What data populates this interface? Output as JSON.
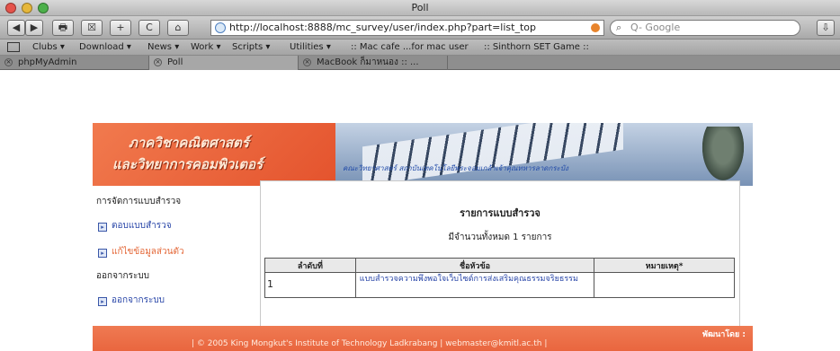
{
  "window": {
    "title": "Poll"
  },
  "toolbar": {
    "back_label": "◀",
    "forward_label": "▶",
    "print_label": "🖶",
    "bookmark_label": "☒",
    "add_label": "+",
    "reload_label": "C",
    "home_label": "⌂",
    "url": "http://localhost:8888/mc_survey/user/index.php?part=list_top",
    "search_placeholder": "Q- Google",
    "sidebar_label": "⇩"
  },
  "bookmarks": [
    "Clubs ▾",
    "Download ▾",
    "News ▾",
    "Work ▾",
    "Scripts ▾",
    "Utilities ▾",
    ":: Mac cafe ...for mac user",
    ":: Sinthorn SET Game ::"
  ],
  "tabs": [
    {
      "label": "phpMyAdmin"
    },
    {
      "label": "Poll"
    },
    {
      "label": "MacBook ก็มาหนอง :: ..."
    }
  ],
  "banner": {
    "line1": "ภาควิชาคณิตศาสตร์",
    "line2": "และวิทยาการคอมพิวเตอร์",
    "caption": "คณะวิทยาศาสตร์ สถาบันเทคโนโลยีพระจอมเกล้าเจ้าคุณทหารลาดกระบัง"
  },
  "sidebar": {
    "section1": "การจัดการแบบสำรวจ",
    "link1": "ตอบแบบสำรวจ",
    "link2": "แก้ไขข้อมูลส่วนตัว",
    "section2": "ออกจากระบบ",
    "link3": "ออกจากระบบ"
  },
  "content": {
    "title": "รายการแบบสำรวจ",
    "subtitle": "มีจำนวนทั้งหมด 1 รายการ",
    "columns": [
      "ลำดับที่",
      "ชื่อหัวข้อ",
      "หมายเหตุ*"
    ],
    "rows": [
      {
        "num": "1",
        "topic": "แบบสำรวจความพึงพอใจเว็บไซต์การส่งเสริมคุณธรรมจริยธรรม",
        "note": ""
      }
    ]
  },
  "footer": {
    "credit": "พัฒนาโดย :",
    "copyright": "| © 2005 King Mongkut's Institute of Technology Ladkrabang | webmaster@kmitl.ac.th |"
  }
}
